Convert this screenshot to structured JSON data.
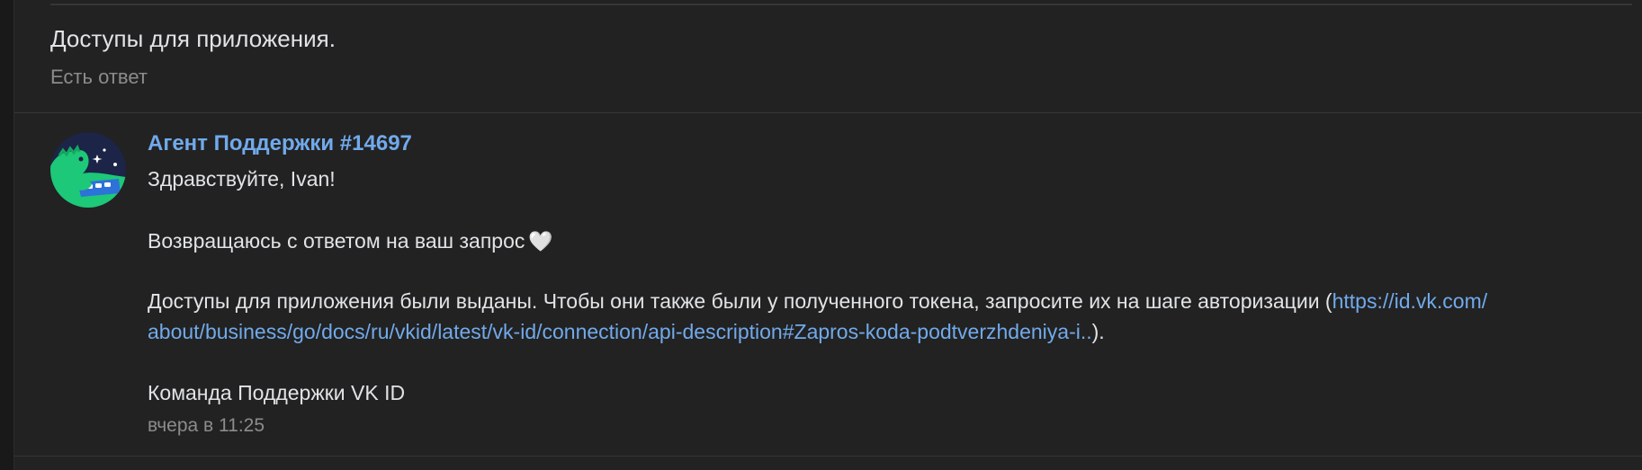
{
  "ticket": {
    "title": "Доступы для приложения.",
    "status": "Есть ответ"
  },
  "message": {
    "author": "Агент Поддержки #14697",
    "greeting": "Здравствуйте, Ivan!",
    "line_returning": "Возвращаюсь с ответом на ваш запрос",
    "heart_icon": "white-heart-icon",
    "line_access_prefix": "Доступы для приложения были выданы. Чтобы они также были у полученного токена, запросите их на шаге авторизации (",
    "link_part1": "https://id.vk.com/",
    "link_part2": "about/business/go/docs/ru/vkid/latest/vk-id/connection/api-description#Zapros-koda-podtverzhdeniya-i..",
    "line_access_suffix": ").",
    "signature": "Команда Поддержки VK ID",
    "timestamp": "вчера в 11:25"
  },
  "colors": {
    "background": "#222222",
    "text": "#e1e3e6",
    "secondary_text": "#8c8c8c",
    "link": "#71aaeb",
    "divider": "#363636"
  }
}
